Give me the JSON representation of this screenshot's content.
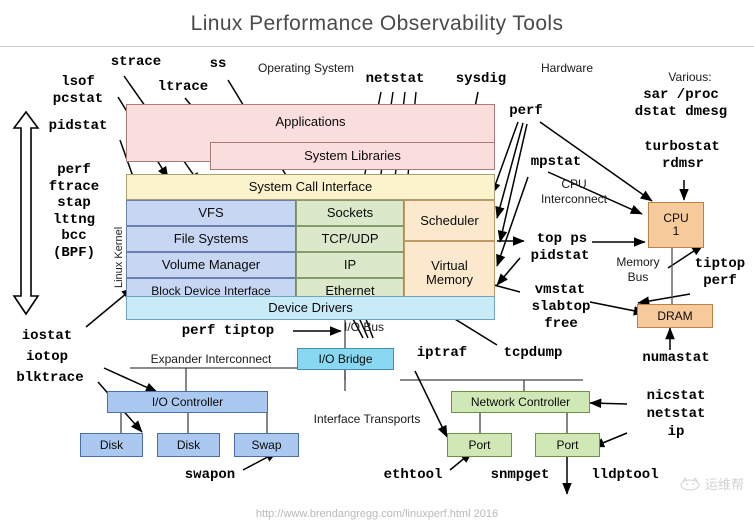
{
  "header": {
    "title": "Linux Performance Observability Tools"
  },
  "footer": {
    "url": "http://www.brendangregg.com/linuxperf.html 2016",
    "watermark": "运维帮"
  },
  "sections": {
    "operating_system": "Operating System",
    "hardware": "Hardware",
    "various": "Various:",
    "linux_kernel": "Linux Kernel",
    "cpu_interconnect": "CPU\nInterconnect",
    "memory_bus": "Memory\nBus",
    "io_bus": "I/O Bus",
    "expander_interconnect": "Expander Interconnect",
    "interface_transports": "Interface Transports"
  },
  "kernel_stack": {
    "applications": "Applications",
    "system_libraries": "System Libraries",
    "system_call_interface": "System Call Interface",
    "vfs": "VFS",
    "file_systems": "File Systems",
    "volume_manager": "Volume Manager",
    "block_device_interface": "Block Device Interface",
    "sockets": "Sockets",
    "tcp_udp": "TCP/UDP",
    "ip": "IP",
    "ethernet": "Ethernet",
    "scheduler": "Scheduler",
    "virtual_memory": "Virtual\nMemory",
    "device_drivers": "Device Drivers"
  },
  "hardware_boxes": {
    "cpu": "CPU\n1",
    "dram": "DRAM",
    "io_bridge": "I/O Bridge",
    "io_controller": "I/O Controller",
    "disk1": "Disk",
    "disk2": "Disk",
    "swap": "Swap",
    "network_controller": "Network Controller",
    "port1": "Port",
    "port2": "Port"
  },
  "tools": {
    "strace": "strace",
    "ss": "ss",
    "lsof": "lsof",
    "ltrace": "ltrace",
    "pcstat": "pcstat",
    "pidstat_left": "pidstat",
    "netstat_top": "netstat",
    "sysdig": "sysdig",
    "perf_top": "perf",
    "mpstat": "mpstat",
    "sar_proc": "sar /proc",
    "dstat_dmesg": "dstat dmesg",
    "turbostat": "turbostat",
    "rdmsr": "rdmsr",
    "perf_block": "perf\nftrace\nstap\nlttng\nbcc\n(BPF)",
    "top_ps": "top ps",
    "pidstat_right": "pidstat",
    "tiptop_perf": "tiptop\nperf",
    "vmstat": "vmstat",
    "slabtop": "slabtop",
    "free": "free",
    "numastat": "numastat",
    "iostat": "iostat",
    "iotop": "iotop",
    "blktrace": "blktrace",
    "perf_tiptop": "perf tiptop",
    "iptraf": "iptraf",
    "tcpdump": "tcpdump",
    "swapon": "swapon",
    "ethtool": "ethtool",
    "snmpget": "snmpget",
    "lldptool": "lldptool",
    "nicstat": "nicstat",
    "netstat_right": "netstat",
    "ip": "ip"
  },
  "colors": {
    "applications": "#fadddd",
    "syscall": "#fbf3cc",
    "fs_stack": "#c7d6f2",
    "net_stack": "#dbe8c9",
    "cpu_mem": "#fce9cd",
    "device_drivers": "#c8ebf7",
    "hardware_disk": "#aac8f0",
    "hardware_net": "#cfe8b6",
    "hardware_cpu": "#f7ca9b",
    "io_bridge": "#87d8f0"
  }
}
